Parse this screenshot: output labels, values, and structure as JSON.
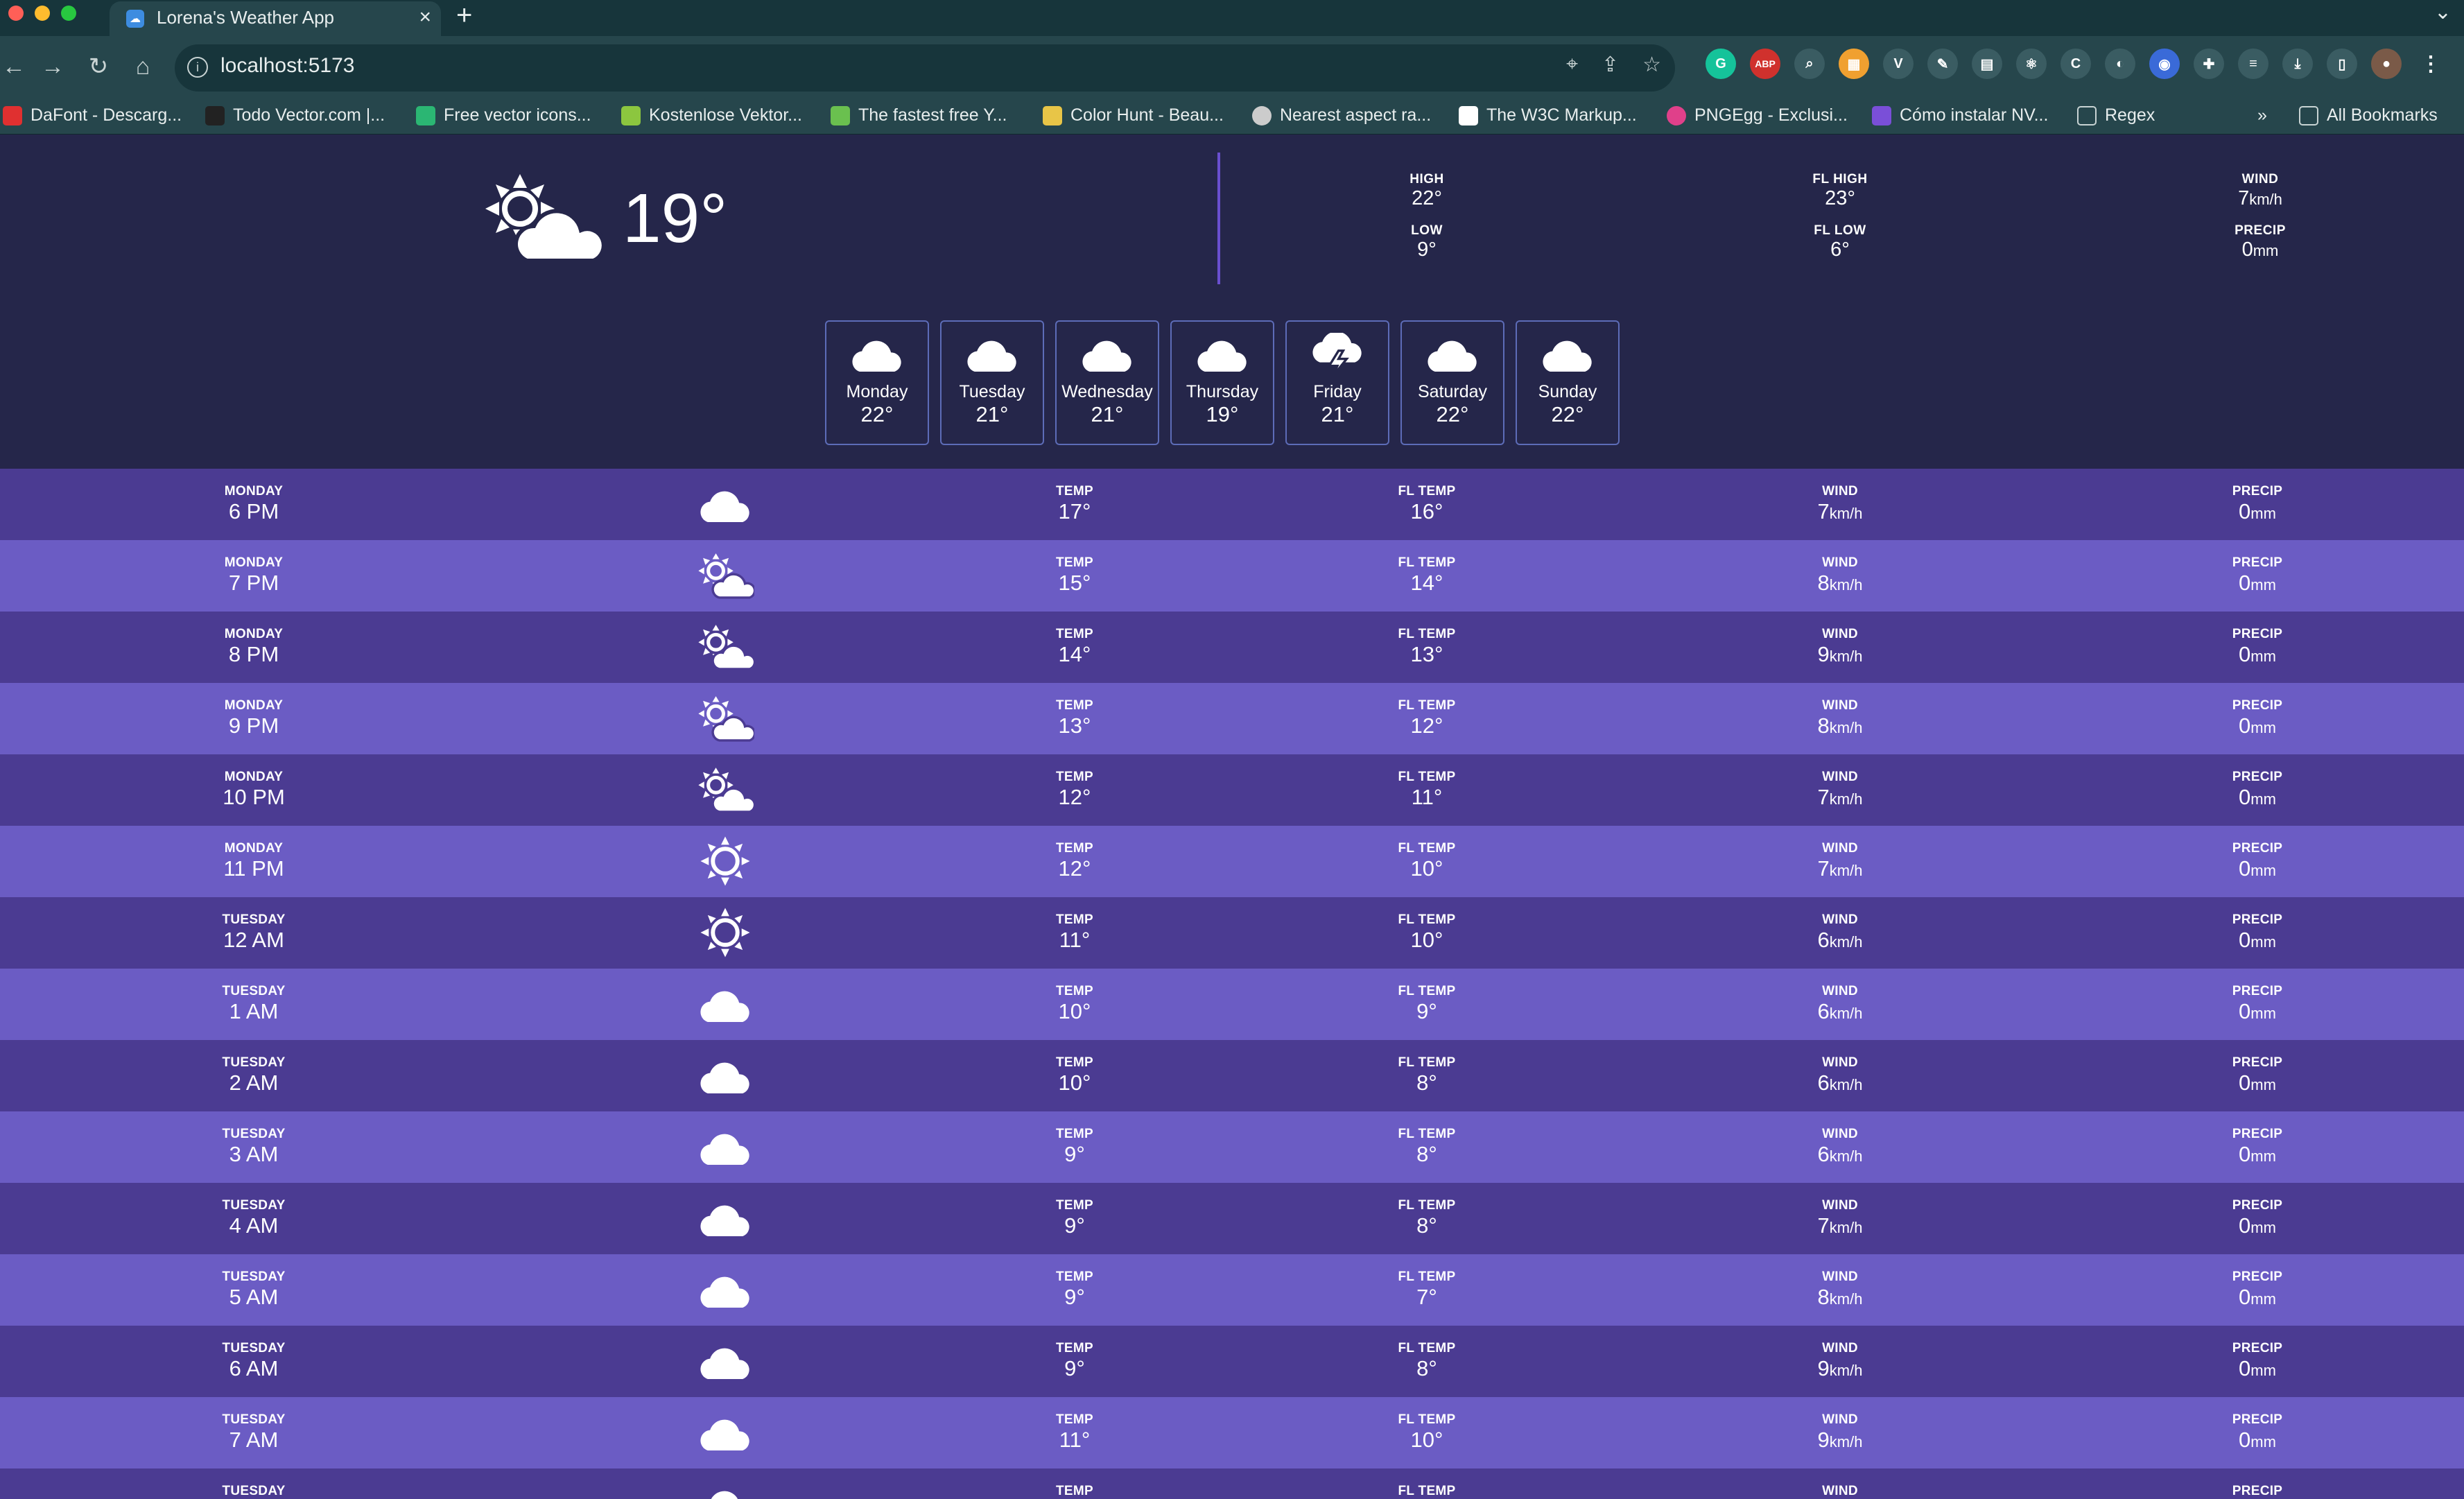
{
  "browser": {
    "tab_title": "Lorena's Weather App",
    "url": "localhost:5173",
    "bookmarks": [
      {
        "label": "DaFont - Descarg...",
        "color": "#e03030"
      },
      {
        "label": "Todo Vector.com |...",
        "color": "#222222"
      },
      {
        "label": "Free vector icons...",
        "color": "#2bb673"
      },
      {
        "label": "Kostenlose Vektor...",
        "color": "#8cc63f"
      },
      {
        "label": "The fastest free Y...",
        "color": "#6ac04f"
      },
      {
        "label": "Color Hunt - Beau...",
        "color": "#e8c547"
      },
      {
        "label": "Nearest aspect ra...",
        "color": "#cccccc"
      },
      {
        "label": "The W3C Markup...",
        "color": "#ffffff"
      },
      {
        "label": "PNGEgg - Exclusi...",
        "color": "#e0408a"
      },
      {
        "label": "Cómo instalar NV...",
        "color": "#7a4fd8"
      },
      {
        "label": "Regex",
        "color": "#c8d3d3"
      }
    ],
    "bookmarks_more": "»",
    "all_bookmarks": "All Bookmarks"
  },
  "current": {
    "temp": "19°",
    "icon": "sun-cloud-icon",
    "high_label": "HIGH",
    "high": "22°",
    "low_label": "LOW",
    "low": "9°",
    "fl_high_label": "FL HIGH",
    "fl_high": "23°",
    "fl_low_label": "FL LOW",
    "fl_low": "6°",
    "wind_label": "WIND",
    "wind": "7",
    "wind_unit": "km/h",
    "precip_label": "PRECIP",
    "precip": "0",
    "precip_unit": "mm"
  },
  "daily": [
    {
      "day": "Monday",
      "temp": "22°",
      "icon": "cloud-icon"
    },
    {
      "day": "Tuesday",
      "temp": "21°",
      "icon": "cloud-icon"
    },
    {
      "day": "Wednesday",
      "temp": "21°",
      "icon": "cloud-icon"
    },
    {
      "day": "Thursday",
      "temp": "19°",
      "icon": "cloud-icon"
    },
    {
      "day": "Friday",
      "temp": "21°",
      "icon": "storm-icon"
    },
    {
      "day": "Saturday",
      "temp": "22°",
      "icon": "cloud-icon"
    },
    {
      "day": "Sunday",
      "temp": "22°",
      "icon": "cloud-icon"
    }
  ],
  "labels": {
    "temp": "TEMP",
    "fl_temp": "FL TEMP",
    "wind": "WIND",
    "precip": "PRECIP",
    "wind_unit": "km/h",
    "precip_unit": "mm"
  },
  "hourly": [
    {
      "day": "MONDAY",
      "time": "6 PM",
      "icon": "cloud-icon",
      "temp": "17°",
      "fl": "16°",
      "wind": "7",
      "precip": "0"
    },
    {
      "day": "MONDAY",
      "time": "7 PM",
      "icon": "sun-cloud-icon",
      "temp": "15°",
      "fl": "14°",
      "wind": "8",
      "precip": "0"
    },
    {
      "day": "MONDAY",
      "time": "8 PM",
      "icon": "sun-cloud-icon",
      "temp": "14°",
      "fl": "13°",
      "wind": "9",
      "precip": "0"
    },
    {
      "day": "MONDAY",
      "time": "9 PM",
      "icon": "sun-cloud-icon",
      "temp": "13°",
      "fl": "12°",
      "wind": "8",
      "precip": "0"
    },
    {
      "day": "MONDAY",
      "time": "10 PM",
      "icon": "sun-cloud-icon",
      "temp": "12°",
      "fl": "11°",
      "wind": "7",
      "precip": "0"
    },
    {
      "day": "MONDAY",
      "time": "11 PM",
      "icon": "sun-icon",
      "temp": "12°",
      "fl": "10°",
      "wind": "7",
      "precip": "0"
    },
    {
      "day": "TUESDAY",
      "time": "12 AM",
      "icon": "sun-icon",
      "temp": "11°",
      "fl": "10°",
      "wind": "6",
      "precip": "0"
    },
    {
      "day": "TUESDAY",
      "time": "1 AM",
      "icon": "cloud-icon",
      "temp": "10°",
      "fl": "9°",
      "wind": "6",
      "precip": "0"
    },
    {
      "day": "TUESDAY",
      "time": "2 AM",
      "icon": "cloud-icon",
      "temp": "10°",
      "fl": "8°",
      "wind": "6",
      "precip": "0"
    },
    {
      "day": "TUESDAY",
      "time": "3 AM",
      "icon": "cloud-icon",
      "temp": "9°",
      "fl": "8°",
      "wind": "6",
      "precip": "0"
    },
    {
      "day": "TUESDAY",
      "time": "4 AM",
      "icon": "cloud-icon",
      "temp": "9°",
      "fl": "8°",
      "wind": "7",
      "precip": "0"
    },
    {
      "day": "TUESDAY",
      "time": "5 AM",
      "icon": "cloud-icon",
      "temp": "9°",
      "fl": "7°",
      "wind": "8",
      "precip": "0"
    },
    {
      "day": "TUESDAY",
      "time": "6 AM",
      "icon": "cloud-icon",
      "temp": "9°",
      "fl": "8°",
      "wind": "9",
      "precip": "0"
    },
    {
      "day": "TUESDAY",
      "time": "7 AM",
      "icon": "cloud-icon",
      "temp": "11°",
      "fl": "10°",
      "wind": "9",
      "precip": "0"
    },
    {
      "day": "TUESDAY",
      "time": "",
      "icon": "cloud-icon",
      "temp": "",
      "fl": "",
      "wind": "",
      "precip": ""
    }
  ],
  "colors": {
    "bg": "#25264a",
    "row_odd": "#4b3b92",
    "row_even": "#6b5cc4",
    "divider": "#6a4fcf",
    "chrome": "#26464c"
  }
}
